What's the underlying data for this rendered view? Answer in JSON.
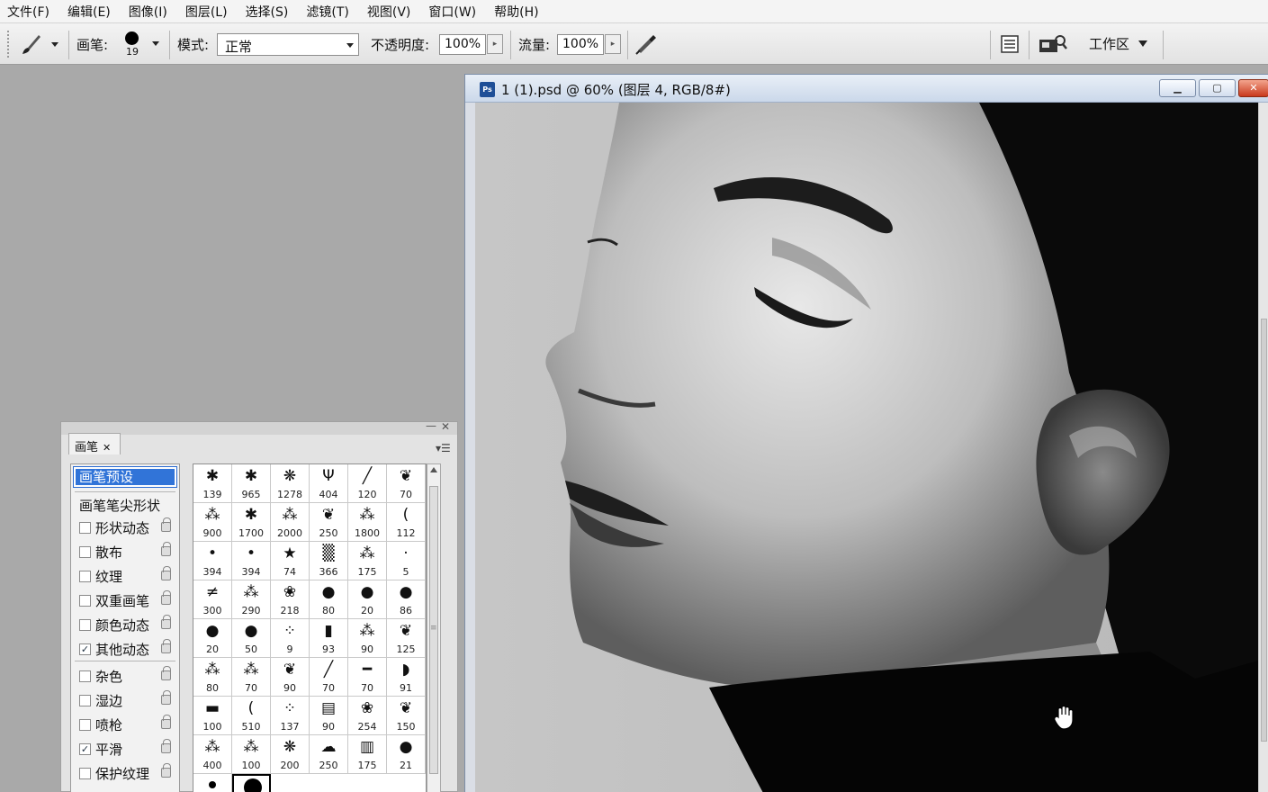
{
  "menu": {
    "items": [
      "文件(F)",
      "编辑(E)",
      "图像(I)",
      "图层(L)",
      "选择(S)",
      "滤镜(T)",
      "视图(V)",
      "窗口(W)",
      "帮助(H)"
    ]
  },
  "options": {
    "brush_label": "画笔:",
    "brush_size": "19",
    "mode_label": "模式:",
    "mode_value": "正常",
    "opacity_label": "不透明度:",
    "opacity_value": "100%",
    "flow_label": "流量:",
    "flow_value": "100%",
    "workspace_label": "工作区"
  },
  "document": {
    "title": "1 (1).psd @ 60% (图层 4, RGB/8#)",
    "ps_badge": "Ps"
  },
  "brush_panel": {
    "tab_label": "画笔",
    "preset_label": "画笔预设",
    "tip_shape_label": "画笔笔尖形状",
    "options": [
      {
        "label": "形状动态",
        "checked": false
      },
      {
        "label": "散布",
        "checked": false
      },
      {
        "label": "纹理",
        "checked": false
      },
      {
        "label": "双重画笔",
        "checked": false
      },
      {
        "label": "颜色动态",
        "checked": false
      },
      {
        "label": "其他动态",
        "checked": true
      },
      {
        "label": "杂色",
        "checked": false
      },
      {
        "label": "湿边",
        "checked": false
      },
      {
        "label": "喷枪",
        "checked": false
      },
      {
        "label": "平滑",
        "checked": true
      },
      {
        "label": "保护纹理",
        "checked": false
      }
    ],
    "sizes": [
      "139",
      "965",
      "1278",
      "404",
      "120",
      "70",
      "900",
      "1700",
      "2000",
      "250",
      "1800",
      "112",
      "394",
      "394",
      "74",
      "366",
      "175",
      "5",
      "300",
      "290",
      "218",
      "80",
      "20",
      "86",
      "20",
      "50",
      "9",
      "93",
      "90",
      "125",
      "80",
      "70",
      "90",
      "70",
      "70",
      "91",
      "100",
      "510",
      "137",
      "90",
      "254",
      "150",
      "400",
      "100",
      "200",
      "250",
      "175",
      "21"
    ],
    "glyphs": [
      "✱",
      "✱",
      "❋",
      "Ψ",
      "╱",
      "❦",
      "⁂",
      "✱",
      "⁂",
      "❦",
      "⁂",
      "(",
      "•",
      "•",
      "★",
      "▒",
      "⁂",
      "·",
      "≠",
      "⁂",
      "❀",
      "●",
      "●",
      "●",
      "●",
      "●",
      "⁘",
      "▮",
      "⁂",
      "❦",
      "⁂",
      "⁂",
      "❦",
      "╱",
      "━",
      "◗",
      "▬",
      "(",
      "⁘",
      "▤",
      "❀",
      "❦",
      "⁂",
      "⁂",
      "❋",
      "☁",
      "▥",
      "●"
    ]
  }
}
